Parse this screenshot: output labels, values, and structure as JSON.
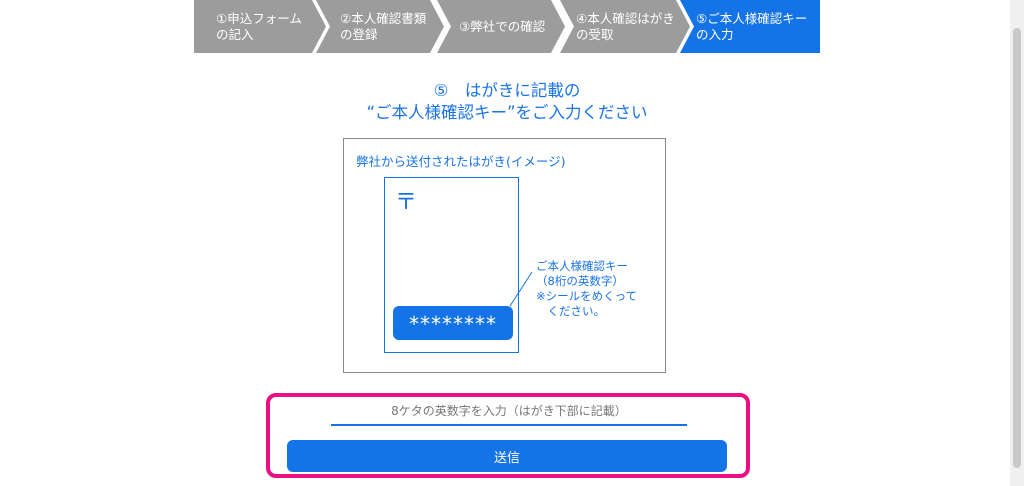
{
  "steps": [
    {
      "label": "①申込フォーム\nの記入"
    },
    {
      "label": "②本人確認書類\nの登録"
    },
    {
      "label": "③弊社での確認"
    },
    {
      "label": "④本人確認はがき\nの受取"
    },
    {
      "label": "⑤ご本人様確認キー\nの入力"
    }
  ],
  "heading": {
    "text": "⑤　はがきに記載の\n“ご本人様確認キー”をご入力ください"
  },
  "illustration": {
    "caption": "弊社から送付されたはがき(イメージ)",
    "postal_mark": "〒",
    "key_mask": "********",
    "callout_lines": [
      "ご本人様確認キー",
      "（8桁の英数字）",
      "※シールをめくって",
      "　ください。"
    ]
  },
  "form": {
    "input_placeholder": "8ケタの英数字を入力（はがき下部に記載）",
    "submit_label": "送信"
  },
  "colors": {
    "accent": "#1473e6",
    "inactive_step": "#9c9c9c",
    "highlight": "#ee0d85"
  }
}
